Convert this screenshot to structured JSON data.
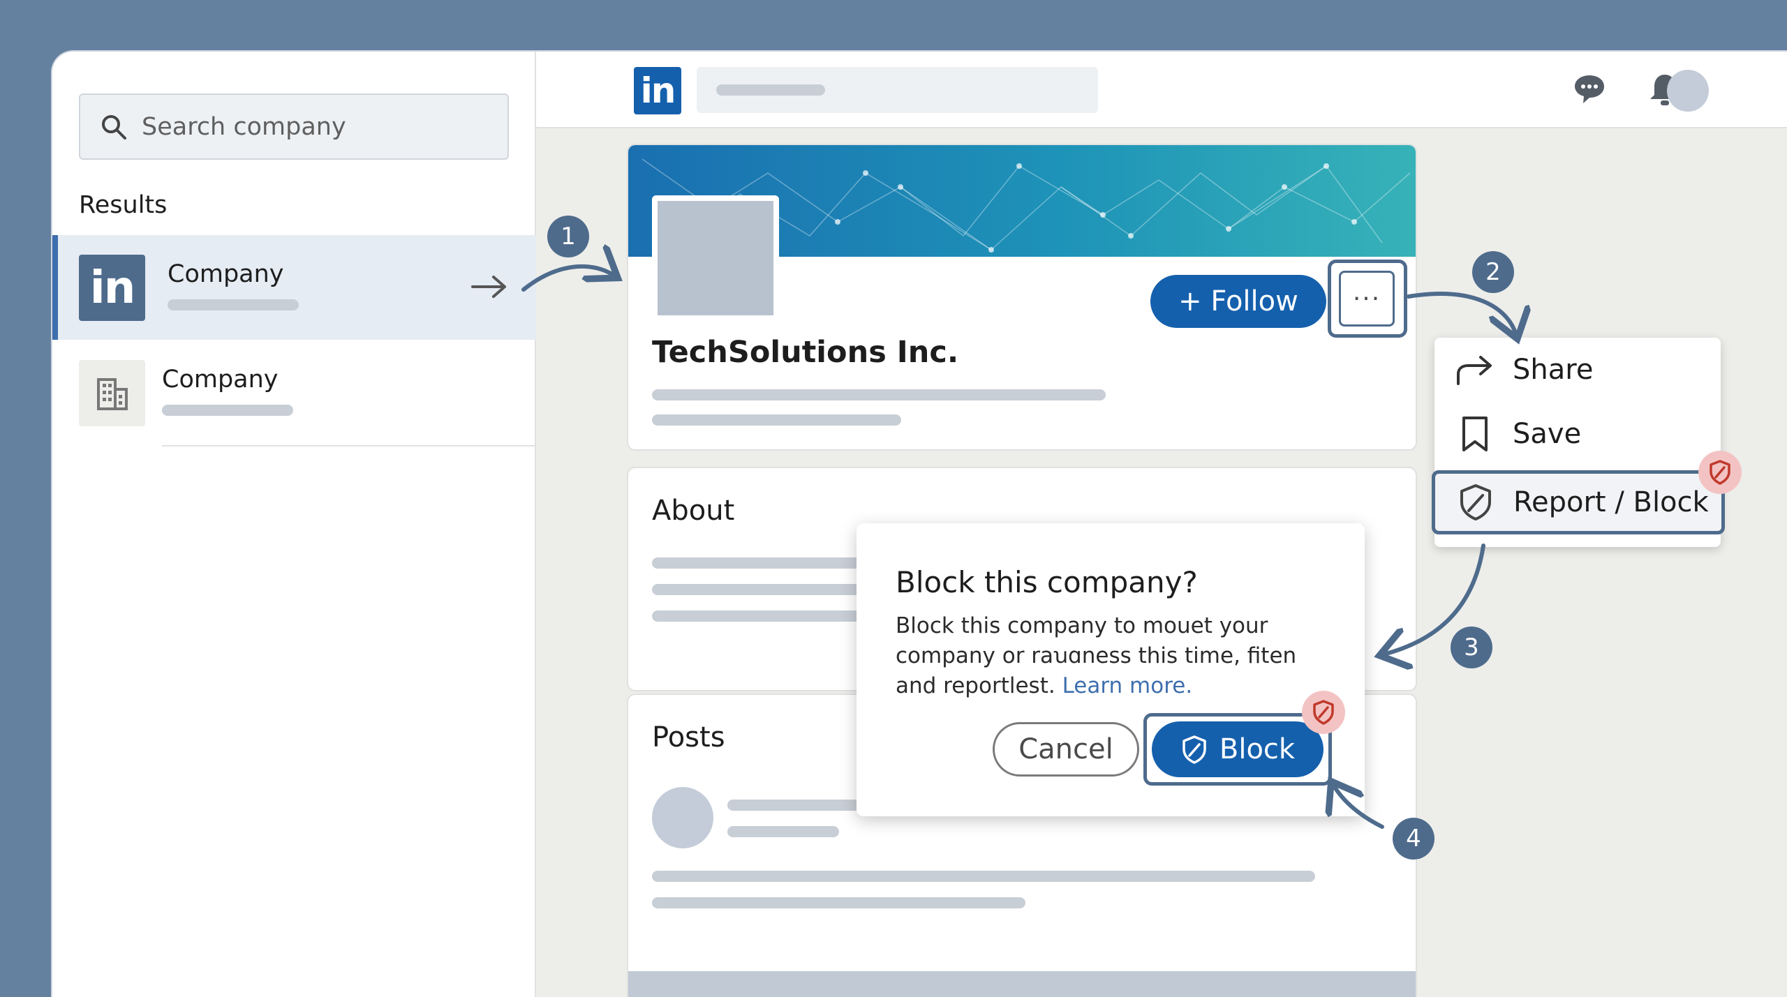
{
  "sidebar": {
    "search_placeholder": "Search company",
    "results_label": "Results",
    "results": [
      {
        "title": "Company",
        "selected": true,
        "logo": "linkedin-in-logo"
      },
      {
        "title": "Company",
        "selected": false,
        "logo": "building-icon"
      }
    ]
  },
  "topbar": {
    "brand": "in",
    "icons": [
      "messaging-icon",
      "bell-icon",
      "avatar"
    ]
  },
  "profile": {
    "company_name": "TechSolutions Inc.",
    "follow_label": "+ Follow",
    "more_label": "···"
  },
  "sections": {
    "about_title": "About",
    "posts_title": "Posts"
  },
  "menu": {
    "items": [
      {
        "label": "Share",
        "icon": "share-arrow-icon"
      },
      {
        "label": "Save",
        "icon": "bookmark-icon"
      },
      {
        "label": "Report / Block",
        "icon": "shield-icon",
        "highlighted": true
      }
    ]
  },
  "dialog": {
    "title": "Block this company?",
    "body": "Block this company to mouet your company or raꭒɑness this time, fiten and reportlest.",
    "link": "Learn more.",
    "cancel_label": "Cancel",
    "block_label": "Block"
  },
  "steps": [
    "1",
    "2",
    "3",
    "4"
  ],
  "colors": {
    "accent": "#1560ad",
    "highlight": "#4e6b8c",
    "badge": "#f3c3c3",
    "badge_icon": "#c0392b"
  }
}
